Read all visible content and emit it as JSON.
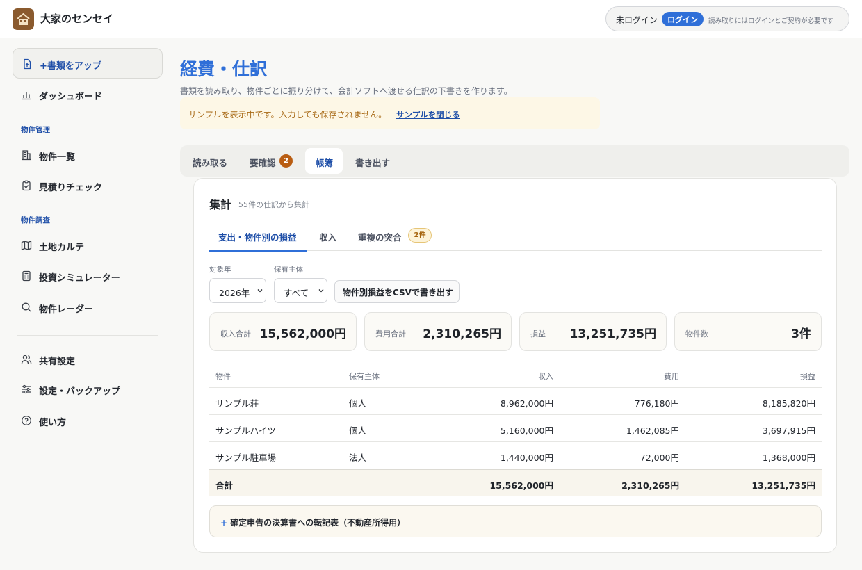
{
  "header": {
    "brand": "大家のセンセイ",
    "login_status": "未ログイン",
    "login_button": "ログイン",
    "login_note": "読み取りにはログインとご契約が必要です"
  },
  "sidebar": {
    "upload": "+書類をアップ",
    "dashboard": "ダッシュボード",
    "section_property": "物件管理",
    "property_list": "物件一覧",
    "estimate_check": "見積りチェック",
    "section_research": "物件調査",
    "land_karte": "土地カルテ",
    "investment_sim": "投資シミュレーター",
    "property_radar": "物件レーダー",
    "share_settings": "共有設定",
    "settings_backup": "設定・バックアップ",
    "how_to_use": "使い方"
  },
  "page": {
    "title": "経費・仕訳",
    "description": "書類を読み取り、物件ごとに振り分けて、会計ソフトへ渡せる仕訳の下書きを作ります。",
    "notice": "サンプルを表示中です。入力しても保存されません。",
    "notice_link": "サンプルを閉じる"
  },
  "tabs": {
    "read": "読み取る",
    "review": "要確認",
    "review_count": "2",
    "ledger": "帳簿",
    "export": "書き出す"
  },
  "summary": {
    "title": "集計",
    "subtitle": "55件の仕訳から集計",
    "subtab_pl": "支出・物件別の損益",
    "subtab_income": "収入",
    "subtab_dup": "重複の突合",
    "dup_count": "2件",
    "year_label": "対象年",
    "year_value": "2026年",
    "owner_label": "保有主体",
    "owner_value": "すべて",
    "csv_button": "物件別損益をCSVで書き出す",
    "stats": {
      "income_label": "収入合計",
      "income_value": "15,562,000円",
      "expense_label": "費用合計",
      "expense_value": "2,310,265円",
      "pl_label": "損益",
      "pl_value": "13,251,735円",
      "count_label": "物件数",
      "count_value": "3件"
    },
    "table": {
      "headers": [
        "物件",
        "保有主体",
        "収入",
        "費用",
        "損益"
      ],
      "rows": [
        [
          "サンプル荘",
          "個人",
          "8,962,000円",
          "776,180円",
          "8,185,820円"
        ],
        [
          "サンプルハイツ",
          "個人",
          "5,160,000円",
          "1,462,085円",
          "3,697,915円"
        ],
        [
          "サンプル駐車場",
          "法人",
          "1,440,000円",
          "72,000円",
          "1,368,000円"
        ]
      ],
      "total": [
        "合計",
        "",
        "15,562,000円",
        "2,310,265円",
        "13,251,735円"
      ]
    },
    "expander": "確定申告の決算書への転記表（不動産所得用）",
    "expander_icon": "+"
  },
  "colors": {
    "accent": "#2f6fd8",
    "brand_dark": "#1f4fa8",
    "badge_orange": "#b95d12",
    "notice_bg": "#fdf7e6"
  }
}
